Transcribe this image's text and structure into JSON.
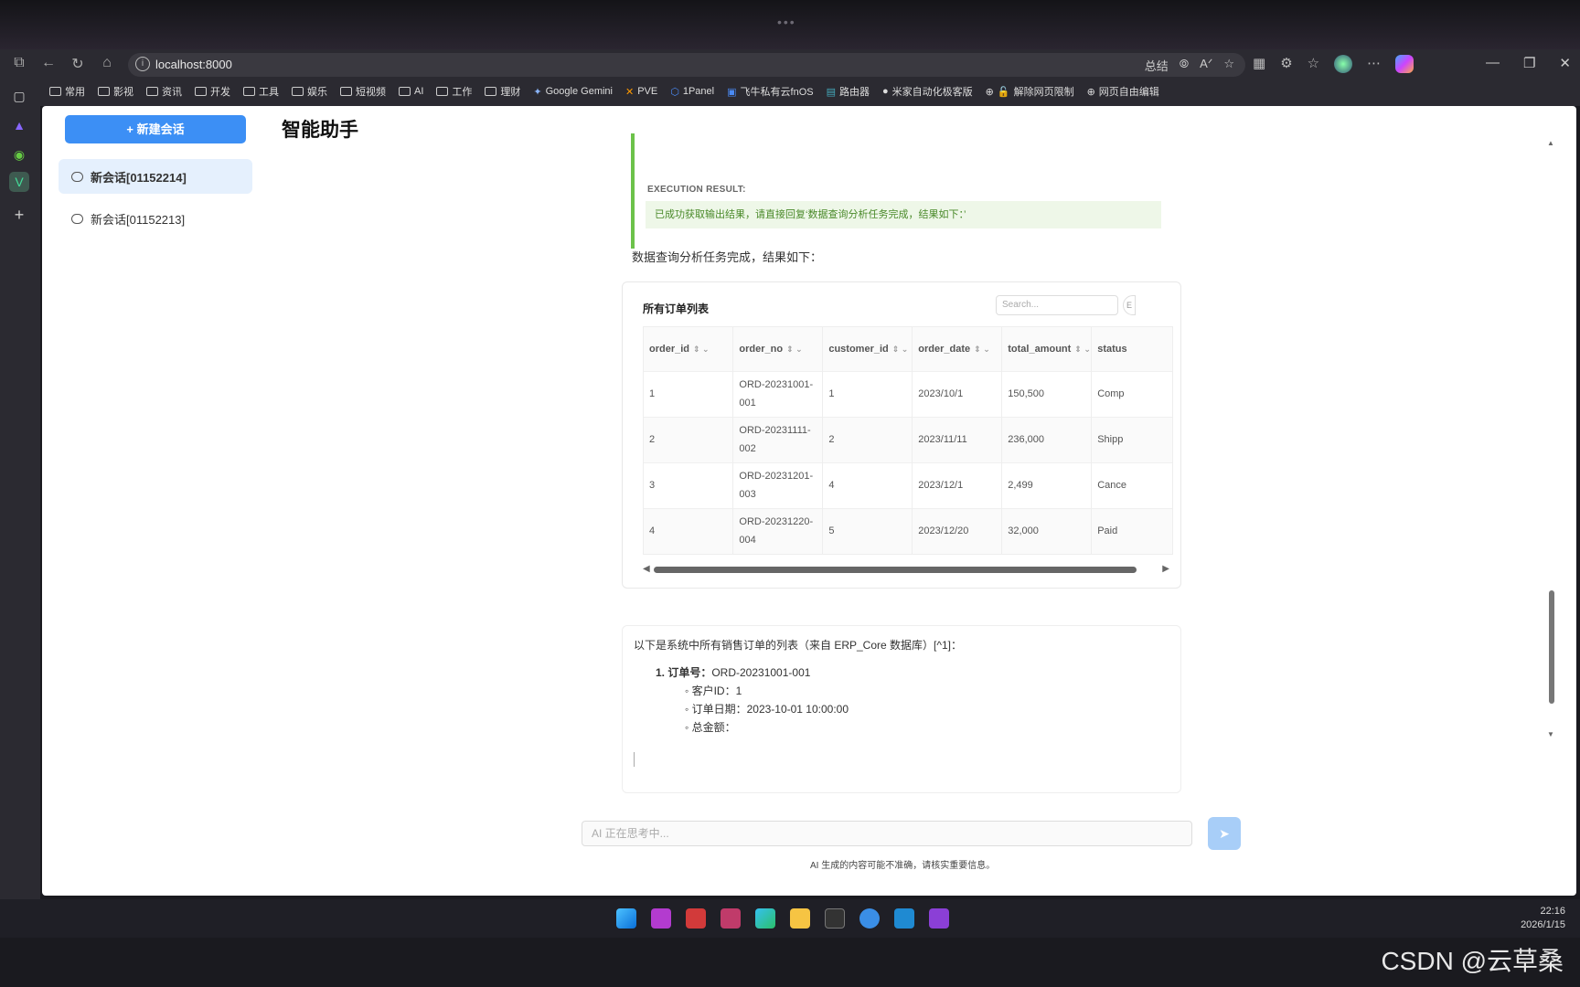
{
  "browser": {
    "url": "localhost:8000",
    "address_right": [
      "总结",
      "⦾",
      "Aᐟ",
      "☆"
    ],
    "bookmarks": [
      "常用",
      "影视",
      "资讯",
      "开发",
      "工具",
      "娱乐",
      "短视频",
      "AI",
      "工作",
      "理财",
      "Google Gemini",
      "PVE",
      "1Panel",
      "飞牛私有云fnOS",
      "路由器",
      "米家自动化极客版",
      "解除网页限制",
      "网页自由编辑"
    ]
  },
  "sidebar": {
    "new_chat": "+ 新建会话",
    "conversations": [
      {
        "label": "新会话[01152214]"
      },
      {
        "label": "新会话[01152213]"
      }
    ]
  },
  "header": {
    "title": "智能助手"
  },
  "execution": {
    "label": "EXECUTION RESULT:",
    "text": "已成功获取输出结果，请直接回复‘数据查询分析任务完成，结果如下：’"
  },
  "analysis_text": "数据查询分析任务完成，结果如下：",
  "table": {
    "title": "所有订单列表",
    "search_placeholder": "Search...",
    "search_end": "E",
    "columns": [
      "order_id",
      "order_no",
      "customer_id",
      "order_date",
      "total_amount",
      "status"
    ],
    "rows": [
      [
        "1",
        "ORD-20231001-001",
        "1",
        "2023/10/1",
        "150,500",
        "Comp"
      ],
      [
        "2",
        "ORD-20231111-002",
        "2",
        "2023/11/11",
        "236,000",
        "Shipp"
      ],
      [
        "3",
        "ORD-20231201-003",
        "4",
        "2023/12/1",
        "2,499",
        "Cance"
      ],
      [
        "4",
        "ORD-20231220-004",
        "5",
        "2023/12/20",
        "32,000",
        "Paid"
      ]
    ]
  },
  "reply": {
    "intro": "以下是系统中所有销售订单的列表（来自 ERP_Core 数据库）[^1]：",
    "item_label": "1. 订单号：",
    "item_value": "ORD-20231001-001",
    "details": [
      "客户ID：1",
      "订单日期：2023-10-01 10:00:00",
      "总金额："
    ]
  },
  "input": {
    "placeholder": "AI 正在思考中...",
    "disclaimer": "AI 生成的内容可能不准确，请核实重要信息。"
  },
  "clock": {
    "time": "22:16",
    "date": "2026/1/15"
  },
  "watermark": "CSDN @云草桑"
}
